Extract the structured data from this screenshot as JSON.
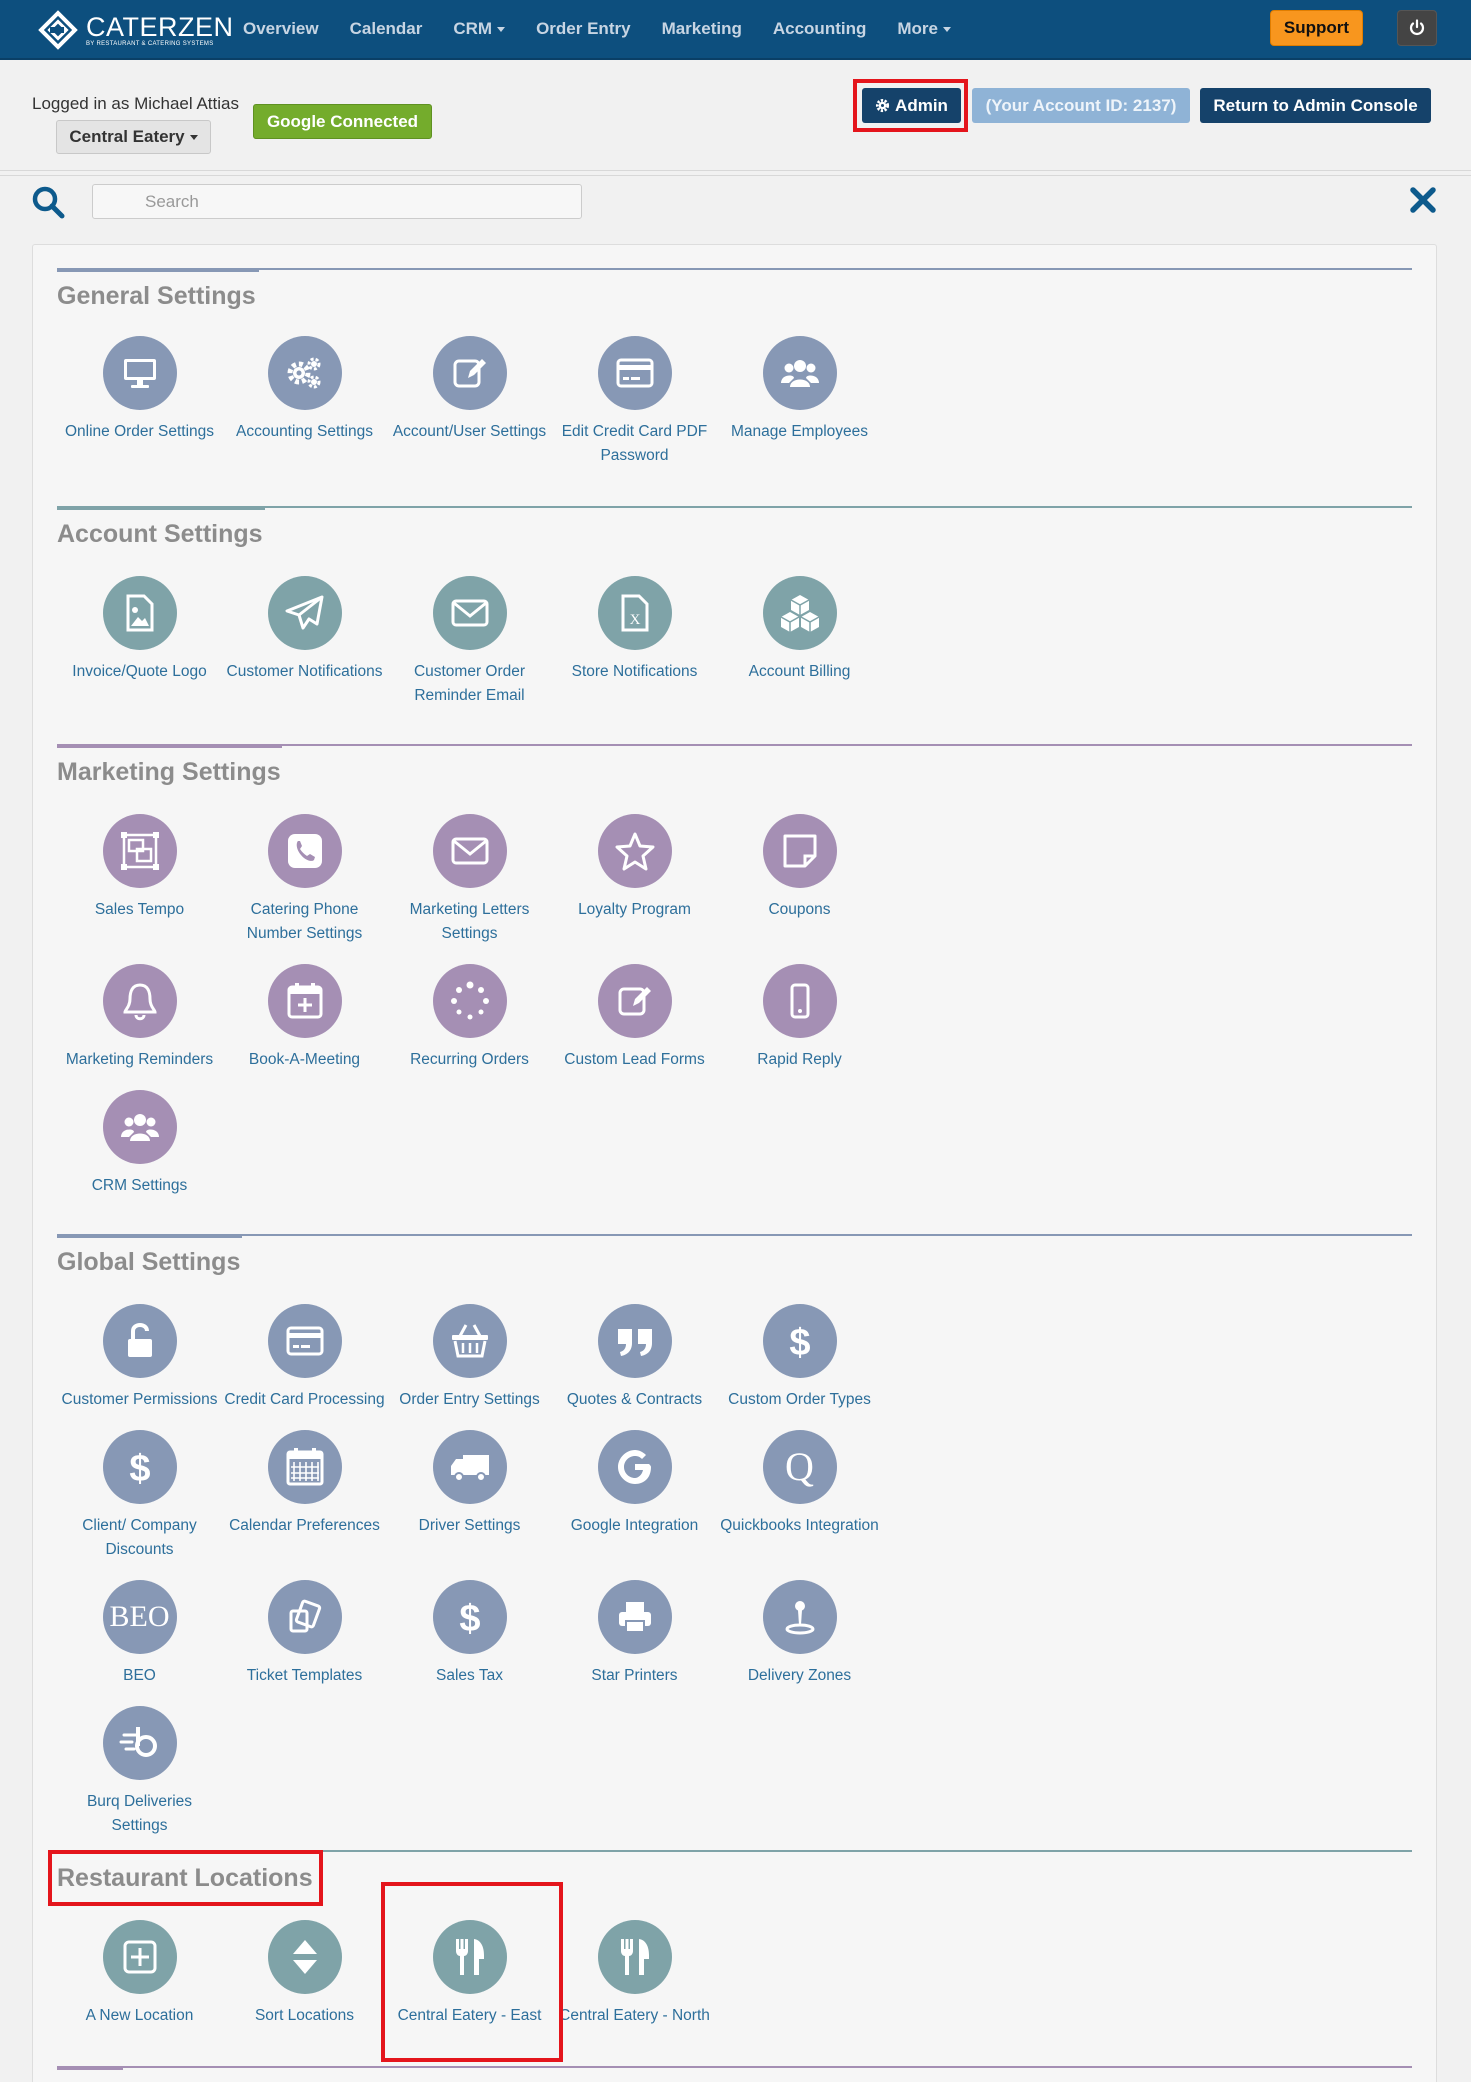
{
  "brand": {
    "name": "CATERZEN",
    "tagline": "by RESTAURANT & CATERING SYSTEMS"
  },
  "nav": {
    "items": [
      {
        "label": "Overview",
        "dropdown": false
      },
      {
        "label": "Calendar",
        "dropdown": false
      },
      {
        "label": "CRM",
        "dropdown": true
      },
      {
        "label": "Order Entry",
        "dropdown": false
      },
      {
        "label": "Marketing",
        "dropdown": false
      },
      {
        "label": "Accounting",
        "dropdown": false
      },
      {
        "label": "More",
        "dropdown": true
      }
    ],
    "support_label": "Support",
    "power_icon": "power-icon"
  },
  "header": {
    "logged_in": "Logged in as Michael Attias",
    "location": "Central Eatery",
    "google": "Google Connected",
    "admin": "Admin",
    "account_id": "(Your Account ID: 2137)",
    "return": "Return to Admin Console"
  },
  "search": {
    "placeholder": "Search"
  },
  "colors": {
    "nav": "#0d4f7e",
    "general": "#8798b5",
    "account": "#7fa3a8",
    "marketing": "#a58fb4",
    "global": "#8798b5",
    "locations": "#7fa3a8",
    "highlight": "#e4151c",
    "support": "#f8961e",
    "google": "#74ac2c"
  },
  "sections": {
    "general": {
      "title": "General Settings",
      "tiles": [
        {
          "label": "Online Order Settings",
          "icon": "monitor-icon"
        },
        {
          "label": "Accounting Settings",
          "icon": "gears-icon"
        },
        {
          "label": "Account/User Settings",
          "icon": "edit-icon"
        },
        {
          "label": "Edit Credit Card PDF Password",
          "icon": "credit-card-icon"
        },
        {
          "label": "Manage Employees",
          "icon": "users-icon"
        }
      ]
    },
    "account": {
      "title": "Account Settings",
      "tiles": [
        {
          "label": "Invoice/Quote Logo",
          "icon": "image-file-icon"
        },
        {
          "label": "Customer Notifications",
          "icon": "paper-plane-icon"
        },
        {
          "label": "Customer Order Reminder Email",
          "icon": "envelope-icon"
        },
        {
          "label": "Store Notifications",
          "icon": "excel-file-icon"
        },
        {
          "label": "Account Billing",
          "icon": "cubes-icon"
        }
      ]
    },
    "marketing": {
      "title": "Marketing Settings",
      "tiles": [
        {
          "label": "Sales Tempo",
          "icon": "object-group-icon"
        },
        {
          "label": "Catering Phone Number Settings",
          "icon": "phone-icon"
        },
        {
          "label": "Marketing Letters Settings",
          "icon": "envelope-icon"
        },
        {
          "label": "Loyalty Program",
          "icon": "star-icon"
        },
        {
          "label": "Coupons",
          "icon": "sticky-note-icon"
        },
        {
          "label": "Marketing Reminders",
          "icon": "bell-icon"
        },
        {
          "label": "Book-A-Meeting",
          "icon": "calendar-plus-icon"
        },
        {
          "label": "Recurring Orders",
          "icon": "spinner-icon"
        },
        {
          "label": "Custom Lead Forms",
          "icon": "edit-icon"
        },
        {
          "label": "Rapid Reply",
          "icon": "mobile-icon"
        },
        {
          "label": "CRM Settings",
          "icon": "users-icon"
        }
      ]
    },
    "global": {
      "title": "Global Settings",
      "tiles": [
        {
          "label": "Customer Permissions",
          "icon": "unlock-icon"
        },
        {
          "label": "Credit Card Processing",
          "icon": "credit-card-icon"
        },
        {
          "label": "Order Entry Settings",
          "icon": "shopping-basket-icon"
        },
        {
          "label": "Quotes & Contracts",
          "icon": "quote-icon"
        },
        {
          "label": "Custom Order Types",
          "icon": "dollar-icon"
        },
        {
          "label": "Client/ Company Discounts",
          "icon": "dollar-icon"
        },
        {
          "label": "Calendar Preferences",
          "icon": "calendar-icon"
        },
        {
          "label": "Driver Settings",
          "icon": "truck-icon"
        },
        {
          "label": "Google Integration",
          "icon": "google-icon"
        },
        {
          "label": "Quickbooks Integration",
          "icon": "quickbooks-icon",
          "glyph": "Q"
        },
        {
          "label": "BEO",
          "icon": "beo-icon",
          "glyph": "BEO"
        },
        {
          "label": "Ticket Templates",
          "icon": "copy-icon"
        },
        {
          "label": "Sales Tax",
          "icon": "dollar-icon"
        },
        {
          "label": "Star Printers",
          "icon": "printer-icon"
        },
        {
          "label": "Delivery Zones",
          "icon": "map-pin-icon"
        },
        {
          "label": "Burq Deliveries Settings",
          "icon": "burq-icon"
        }
      ]
    },
    "locations": {
      "title": "Restaurant Locations",
      "tiles": [
        {
          "label": "A New Location",
          "icon": "plus-square-icon"
        },
        {
          "label": "Sort Locations",
          "icon": "sort-icon"
        },
        {
          "label": "Central Eatery - East",
          "icon": "cutlery-icon"
        },
        {
          "label": "Central Eatery - North",
          "icon": "cutlery-icon"
        }
      ]
    }
  }
}
